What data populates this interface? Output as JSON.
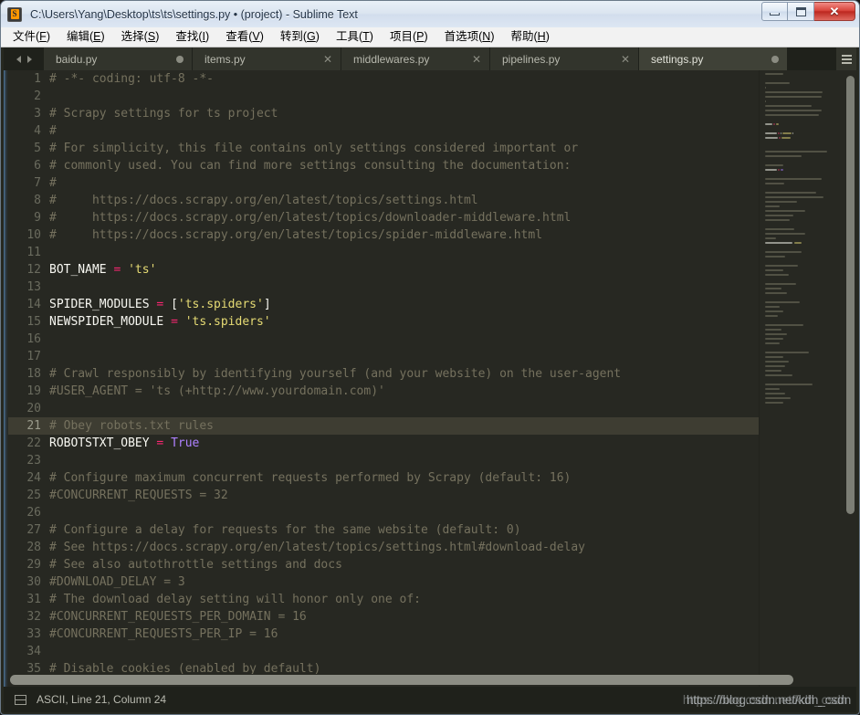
{
  "window": {
    "title": "C:\\Users\\Yang\\Desktop\\ts\\ts\\settings.py • (project) - Sublime Text",
    "app_icon": "sublime-text-icon",
    "minimize_label": "",
    "maximize_label": "",
    "close_label": "✕"
  },
  "menubar": {
    "items": [
      {
        "text": "文件",
        "mnemonic": "F"
      },
      {
        "text": "编辑",
        "mnemonic": "E"
      },
      {
        "text": "选择",
        "mnemonic": "S"
      },
      {
        "text": "查找",
        "mnemonic": "I"
      },
      {
        "text": "查看",
        "mnemonic": "V"
      },
      {
        "text": "转到",
        "mnemonic": "G"
      },
      {
        "text": "工具",
        "mnemonic": "T"
      },
      {
        "text": "项目",
        "mnemonic": "P"
      },
      {
        "text": "首选项",
        "mnemonic": "N"
      },
      {
        "text": "帮助",
        "mnemonic": "H"
      }
    ]
  },
  "tabs": {
    "prev_arrow": "chevron-left-icon",
    "next_arrow": "chevron-right-icon",
    "menu_icon": "hamburger-menu-icon",
    "items": [
      {
        "label": "baidu.py",
        "active": false,
        "dirty": true,
        "close_glyph": "●"
      },
      {
        "label": "items.py",
        "active": false,
        "dirty": false,
        "close_glyph": "✕"
      },
      {
        "label": "middlewares.py",
        "active": false,
        "dirty": false,
        "close_glyph": "✕"
      },
      {
        "label": "pipelines.py",
        "active": false,
        "dirty": false,
        "close_glyph": "✕"
      },
      {
        "label": "settings.py",
        "active": true,
        "dirty": true,
        "close_glyph": "●"
      }
    ]
  },
  "editor": {
    "current_line": 21,
    "first_visible_line": 1,
    "colors": {
      "background": "#272822",
      "current_line": "#3e3d32",
      "comment": "#75715e",
      "string": "#e6db74",
      "operator": "#f92672",
      "constant": "#ae81ff",
      "plain": "#f8f8f2",
      "line_number": "#6a6b5e"
    },
    "lines": [
      {
        "n": 1,
        "tokens": [
          {
            "t": "# -*- coding: utf-8 -*-",
            "c": "cm"
          }
        ]
      },
      {
        "n": 2,
        "tokens": []
      },
      {
        "n": 3,
        "tokens": [
          {
            "t": "# Scrapy settings for ts project",
            "c": "cm"
          }
        ]
      },
      {
        "n": 4,
        "tokens": [
          {
            "t": "#",
            "c": "cm"
          }
        ]
      },
      {
        "n": 5,
        "tokens": [
          {
            "t": "# For simplicity, this file contains only settings considered important or",
            "c": "cm"
          }
        ]
      },
      {
        "n": 6,
        "tokens": [
          {
            "t": "# commonly used. You can find more settings consulting the documentation:",
            "c": "cm"
          }
        ]
      },
      {
        "n": 7,
        "tokens": [
          {
            "t": "#",
            "c": "cm"
          }
        ]
      },
      {
        "n": 8,
        "tokens": [
          {
            "t": "#     https://docs.scrapy.org/en/latest/topics/settings.html",
            "c": "cm"
          }
        ]
      },
      {
        "n": 9,
        "tokens": [
          {
            "t": "#     https://docs.scrapy.org/en/latest/topics/downloader-middleware.html",
            "c": "cm"
          }
        ]
      },
      {
        "n": 10,
        "tokens": [
          {
            "t": "#     https://docs.scrapy.org/en/latest/topics/spider-middleware.html",
            "c": "cm"
          }
        ]
      },
      {
        "n": 11,
        "tokens": []
      },
      {
        "n": 12,
        "tokens": [
          {
            "t": "BOT_NAME ",
            "c": "vr"
          },
          {
            "t": "= ",
            "c": "op"
          },
          {
            "t": "'ts'",
            "c": "st"
          }
        ]
      },
      {
        "n": 13,
        "tokens": []
      },
      {
        "n": 14,
        "tokens": [
          {
            "t": "SPIDER_MODULES ",
            "c": "vr"
          },
          {
            "t": "= ",
            "c": "op"
          },
          {
            "t": "[",
            "c": "pn"
          },
          {
            "t": "'ts.spiders'",
            "c": "st"
          },
          {
            "t": "]",
            "c": "pn"
          }
        ]
      },
      {
        "n": 15,
        "tokens": [
          {
            "t": "NEWSPIDER_MODULE ",
            "c": "vr"
          },
          {
            "t": "= ",
            "c": "op"
          },
          {
            "t": "'ts.spiders'",
            "c": "st"
          }
        ]
      },
      {
        "n": 16,
        "tokens": []
      },
      {
        "n": 17,
        "tokens": []
      },
      {
        "n": 18,
        "tokens": [
          {
            "t": "# Crawl responsibly by identifying yourself (and your website) on the user-agent",
            "c": "cm"
          }
        ]
      },
      {
        "n": 19,
        "tokens": [
          {
            "t": "#USER_AGENT = 'ts (+http://www.yourdomain.com)'",
            "c": "cm"
          }
        ]
      },
      {
        "n": 20,
        "tokens": []
      },
      {
        "n": 21,
        "tokens": [
          {
            "t": "# Obey robots.txt rules",
            "c": "cm"
          }
        ]
      },
      {
        "n": 22,
        "tokens": [
          {
            "t": "ROBOTSTXT_OBEY ",
            "c": "vr"
          },
          {
            "t": "= ",
            "c": "op"
          },
          {
            "t": "True",
            "c": "kw"
          }
        ]
      },
      {
        "n": 23,
        "tokens": []
      },
      {
        "n": 24,
        "tokens": [
          {
            "t": "# Configure maximum concurrent requests performed by Scrapy (default: 16)",
            "c": "cm"
          }
        ]
      },
      {
        "n": 25,
        "tokens": [
          {
            "t": "#CONCURRENT_REQUESTS = 32",
            "c": "cm"
          }
        ]
      },
      {
        "n": 26,
        "tokens": []
      },
      {
        "n": 27,
        "tokens": [
          {
            "t": "# Configure a delay for requests for the same website (default: 0)",
            "c": "cm"
          }
        ]
      },
      {
        "n": 28,
        "tokens": [
          {
            "t": "# See https://docs.scrapy.org/en/latest/topics/settings.html#download-delay",
            "c": "cm"
          }
        ]
      },
      {
        "n": 29,
        "tokens": [
          {
            "t": "# See also autothrottle settings and docs",
            "c": "cm"
          }
        ]
      },
      {
        "n": 30,
        "tokens": [
          {
            "t": "#DOWNLOAD_DELAY = 3",
            "c": "cm"
          }
        ]
      },
      {
        "n": 31,
        "tokens": [
          {
            "t": "# The download delay setting will honor only one of:",
            "c": "cm"
          }
        ]
      },
      {
        "n": 32,
        "tokens": [
          {
            "t": "#CONCURRENT_REQUESTS_PER_DOMAIN = 16",
            "c": "cm"
          }
        ]
      },
      {
        "n": 33,
        "tokens": [
          {
            "t": "#CONCURRENT_REQUESTS_PER_IP = 16",
            "c": "cm"
          }
        ]
      },
      {
        "n": 34,
        "tokens": []
      },
      {
        "n": 35,
        "tokens": [
          {
            "t": "# Disable cookies (enabled by default)",
            "c": "cm"
          }
        ]
      }
    ]
  },
  "statusbar": {
    "panel_icon": "panel-toggle-icon",
    "text": "ASCII, Line 21, Column 24"
  },
  "overlay": {
    "watermark": "https://blog.csdn.net/kdh_csdn"
  }
}
